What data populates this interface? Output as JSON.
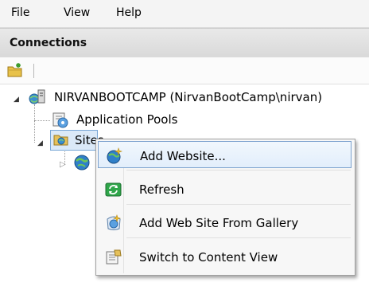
{
  "menubar": {
    "items": [
      {
        "label": "File"
      },
      {
        "label": "View"
      },
      {
        "label": "Help"
      }
    ]
  },
  "connections": {
    "title": "Connections"
  },
  "tree": {
    "server": "NIRVANBOOTCAMP (NirvanBootCamp\\nirvan)",
    "app_pools": "Application Pools",
    "sites": "Sites"
  },
  "context_menu": {
    "items": [
      {
        "label": "Add Website...",
        "icon": "add-website-icon",
        "highlighted": true
      },
      {
        "label": "Refresh",
        "icon": "refresh-icon"
      },
      {
        "label": "Add Web Site From Gallery",
        "icon": "gallery-icon"
      },
      {
        "label": "Switch to Content View",
        "icon": "content-view-icon"
      }
    ]
  }
}
